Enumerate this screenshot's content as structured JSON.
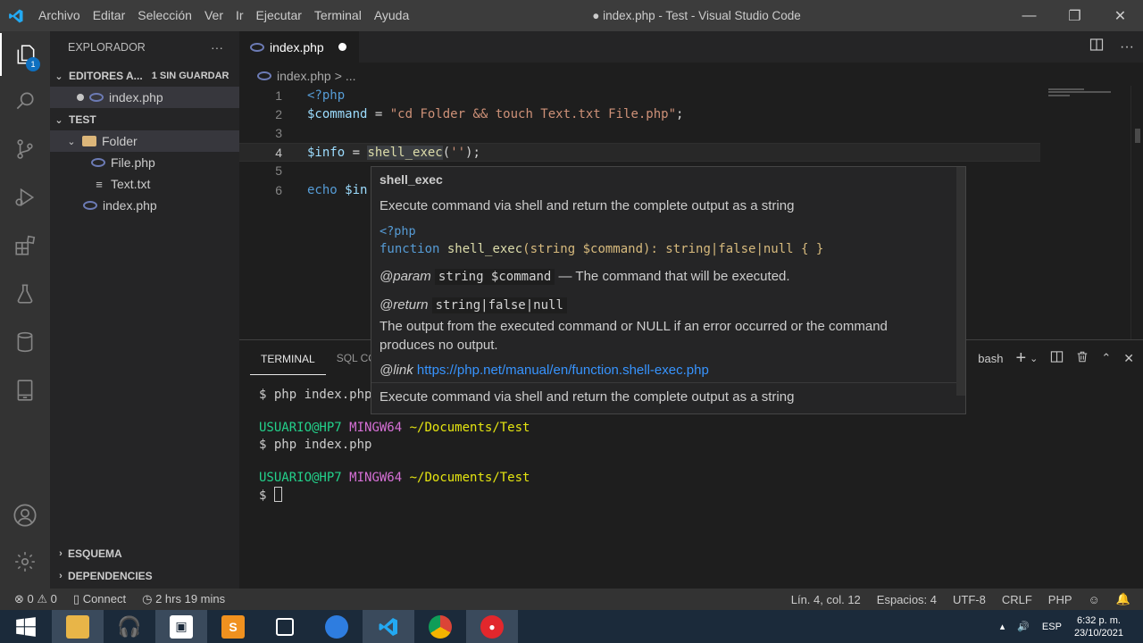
{
  "titlebar": {
    "menu": [
      "Archivo",
      "Editar",
      "Selección",
      "Ver",
      "Ir",
      "Ejecutar",
      "Terminal",
      "Ayuda"
    ],
    "window_title": "● index.php - Test - Visual Studio Code"
  },
  "activity": {
    "explorer_badge": "1"
  },
  "sidebar": {
    "header": "EXPLORADOR",
    "more": "···",
    "open_editors_label": "EDITORES A...",
    "unsaved_label": "1 SIN GUARDAR",
    "open_file": "index.php",
    "project": "TEST",
    "folder": "Folder",
    "folder_files": [
      "File.php",
      "Text.txt"
    ],
    "root_file": "index.php",
    "outline": "ESQUEMA",
    "dependencies": "DEPENDENCIES"
  },
  "tabs": [
    {
      "label": "index.php",
      "modified": true
    }
  ],
  "breadcrumb": {
    "file": "index.php",
    "sep": ">",
    "rest": "..."
  },
  "editor": {
    "line_numbers": [
      "1",
      "2",
      "3",
      "4",
      "5",
      "6"
    ],
    "lines": {
      "l1": "<?php",
      "l2_var": "$command",
      "l2_eq": " = ",
      "l2_str": "\"cd Folder && touch Text.txt File.php\"",
      "l2_end": ";",
      "l4_var": "$info",
      "l4_eq": " = ",
      "l4_fn": "shell_exec",
      "l4_open": "(",
      "l4_str": "''",
      "l4_close": ");",
      "l6_kw": "echo",
      "l6_var": " $in"
    }
  },
  "hover": {
    "title": "shell_exec",
    "description": "Execute command via shell and return the complete output as a string",
    "php_open": "<?php",
    "signature_kw": "function",
    "signature_name": " shell_exec",
    "signature_args": "(string $command): string|false|null { }",
    "param_tag": "@param",
    "param_code": "string $command",
    "param_desc": " — The command that will be executed.",
    "return_tag": "@return",
    "return_code": "string|false|null",
    "return_desc": "The output from the executed command or NULL if an error occurred or the command produces no output.",
    "link_tag": "@link",
    "link_url": "https://php.net/manual/en/function.shell-exec.php",
    "footer": "Execute command via shell and return the complete output as a string"
  },
  "panel": {
    "tabs": [
      "TERMINAL",
      "SQL CO"
    ],
    "shell": "bash",
    "lines": {
      "cmd1": "$ php index.php",
      "user": "USUARIO@HP7",
      "ming": "MINGW64",
      "path": "~/Documents/Test",
      "cmd2": "$ php index.php",
      "prompt": "$ "
    }
  },
  "statusbar": {
    "errors": "0",
    "warnings": "0",
    "connect": "Connect",
    "time": "2 hrs 19 mins",
    "position": "Lín. 4, col. 12",
    "spaces": "Espacios: 4",
    "encoding": "UTF-8",
    "eol": "CRLF",
    "language": "PHP"
  },
  "taskbar": {
    "lang": "ESP",
    "time": "6:32 p. m.",
    "date": "23/10/2021"
  }
}
